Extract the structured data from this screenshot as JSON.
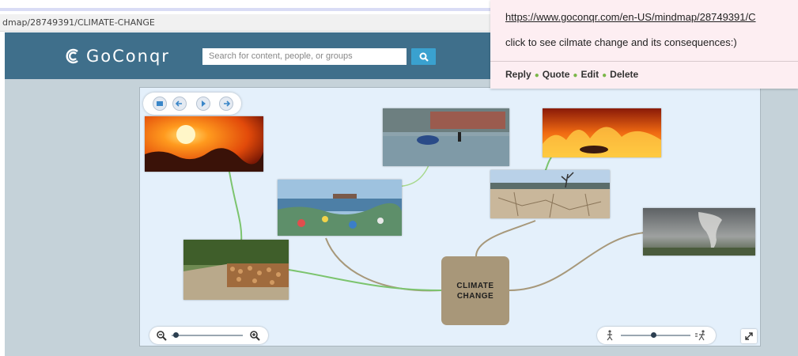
{
  "browser": {
    "url_fragment": "dmap/28749391/CLIMATE-CHANGE"
  },
  "header": {
    "logo_text": "GoConqr",
    "search_placeholder": "Search for content, people, or groups"
  },
  "mindmap": {
    "central_topic": "CLIMATE\nCHANGE",
    "images": [
      "sun-heatwave-image",
      "flood-image",
      "wildfire-image",
      "plastic-pollution-image",
      "drought-image",
      "tornado-image",
      "deforestation-image"
    ],
    "colors": {
      "canvas": "#e4f0fb",
      "central_node": "#a89779",
      "link_green": "#7cc46e",
      "link_brown": "#a7987a"
    }
  },
  "popup": {
    "url": "https://www.goconqr.com/en-US/mindmap/28749391/C",
    "comment": "click to see cilmate change and its consequences:)",
    "actions": [
      "Reply",
      "Quote",
      "Edit",
      "Delete"
    ]
  }
}
